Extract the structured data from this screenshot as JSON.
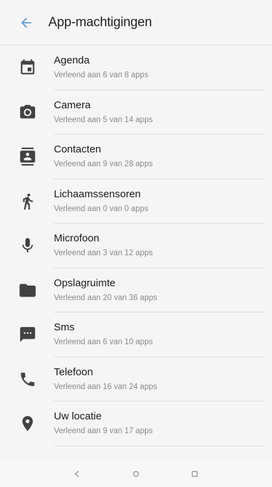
{
  "header": {
    "title": "App-machtigingen",
    "back_icon": "arrow-left-icon"
  },
  "permissions": [
    {
      "name": "Agenda",
      "sub": "Verleend aan 6 van 8 apps",
      "icon": "calendar-icon"
    },
    {
      "name": "Camera",
      "sub": "Verleend aan 5 van 14 apps",
      "icon": "camera-icon"
    },
    {
      "name": "Contacten",
      "sub": "Verleend aan 9 van 28 apps",
      "icon": "contacts-icon"
    },
    {
      "name": "Lichaamssensoren",
      "sub": "Verleend aan 0 van 0 apps",
      "icon": "body-sensors-icon"
    },
    {
      "name": "Microfoon",
      "sub": "Verleend aan 3 van 12 apps",
      "icon": "microphone-icon"
    },
    {
      "name": "Opslagruimte",
      "sub": "Verleend aan 20 van 36 apps",
      "icon": "folder-icon"
    },
    {
      "name": "Sms",
      "sub": "Verleend aan 6 van 10 apps",
      "icon": "sms-icon"
    },
    {
      "name": "Telefoon",
      "sub": "Verleend aan 16 van 24 apps",
      "icon": "phone-icon"
    },
    {
      "name": "Uw locatie",
      "sub": "Verleend aan 9 van 17 apps",
      "icon": "location-icon"
    }
  ],
  "navigation": {
    "back": "nav-back-icon",
    "home": "nav-home-icon",
    "recents": "nav-recents-icon"
  },
  "colors": {
    "accent": "#4a90e2",
    "icon": "#424242",
    "background": "#f5f5f5"
  }
}
